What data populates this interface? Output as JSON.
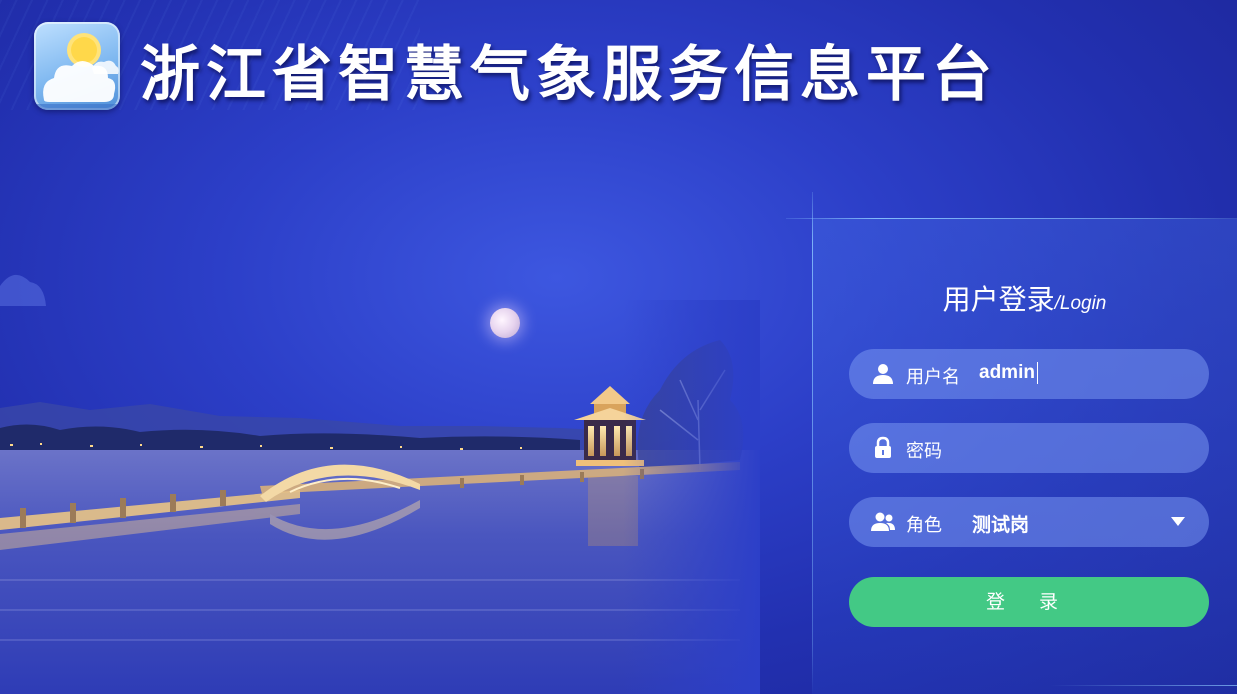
{
  "header": {
    "title": "浙江省智慧气象服务信息平台",
    "logo_icon": "sun-cloud-icon"
  },
  "login": {
    "title_zh": "用户登录",
    "title_en": "/Login",
    "username": {
      "label": "用户名",
      "value": "admin",
      "icon": "user-icon"
    },
    "password": {
      "label": "密码",
      "value": "",
      "icon": "lock-icon"
    },
    "role": {
      "label": "角色",
      "value": "测试岗",
      "icon": "users-icon",
      "dropdown_icon": "caret-down-icon"
    },
    "submit_label": "登 录"
  },
  "colors": {
    "background": "#2c3fc8",
    "field_bg": "#7896f0",
    "login_button": "#43c985",
    "text": "#ffffff"
  }
}
